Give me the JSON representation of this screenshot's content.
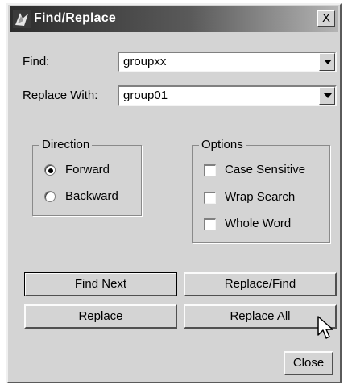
{
  "window": {
    "title": "Find/Replace",
    "close_glyph": "X"
  },
  "find": {
    "label": "Find:",
    "value": "groupxx"
  },
  "replace": {
    "label": "Replace With:",
    "value": "group01"
  },
  "direction": {
    "title": "Direction",
    "options": [
      {
        "label": "Forward",
        "selected": true
      },
      {
        "label": "Backward",
        "selected": false
      }
    ]
  },
  "options_group": {
    "title": "Options",
    "items": [
      {
        "label": "Case Sensitive",
        "checked": false
      },
      {
        "label": "Wrap Search",
        "checked": false
      },
      {
        "label": "Whole Word",
        "checked": false
      }
    ]
  },
  "buttons": {
    "find_next": "Find Next",
    "replace_find": "Replace/Find",
    "replace": "Replace",
    "replace_all": "Replace All",
    "close": "Close"
  },
  "colors": {
    "face": "#d4d4d4",
    "title_start": "#2c2c2c",
    "title_end": "#b5b5b5"
  },
  "icons": [
    "app-icon",
    "close-icon",
    "dropdown-arrow-icon",
    "mouse-pointer-icon"
  ]
}
